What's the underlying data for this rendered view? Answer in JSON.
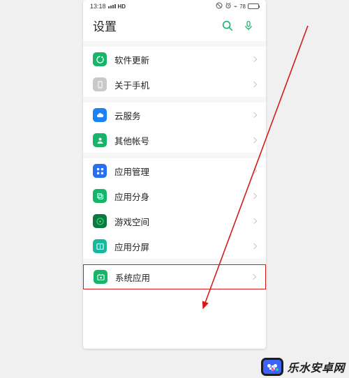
{
  "status": {
    "time": "13:18",
    "hd": "HD",
    "battery_pct": "78"
  },
  "header": {
    "title": "设置"
  },
  "colors": {
    "green": "#16b56a",
    "blue": "#1d83f2",
    "gray": "#c7c7c7",
    "dark_green": "#0f8f4e",
    "teal": "#18b79e",
    "appgrid": "#2a6ff2",
    "highlight": "#d31b1b"
  },
  "sections": [
    {
      "items": [
        {
          "label": "软件更新",
          "icon": "update-icon",
          "icon_bg": "#16b56a"
        },
        {
          "label": "关于手机",
          "icon": "phone-info-icon",
          "icon_bg": "#c9c9c9"
        }
      ]
    },
    {
      "items": [
        {
          "label": "云服务",
          "icon": "cloud-icon",
          "icon_bg": "#1d83f2"
        },
        {
          "label": "其他帐号",
          "icon": "account-icon",
          "icon_bg": "#16b56a"
        }
      ]
    },
    {
      "items": [
        {
          "label": "应用管理",
          "icon": "apps-grid-icon",
          "icon_bg": "#2a6ff2"
        },
        {
          "label": "应用分身",
          "icon": "clone-icon",
          "icon_bg": "#16b56a"
        },
        {
          "label": "游戏空间",
          "icon": "game-icon",
          "icon_bg": "#0b7a3f"
        },
        {
          "label": "应用分屏",
          "icon": "split-screen-icon",
          "icon_bg": "#18b79e"
        }
      ]
    },
    {
      "items": [
        {
          "label": "系统应用",
          "icon": "system-app-icon",
          "icon_bg": "#16b56a",
          "highlight": true
        }
      ]
    }
  ],
  "watermark": {
    "text": "乐水安卓网"
  }
}
